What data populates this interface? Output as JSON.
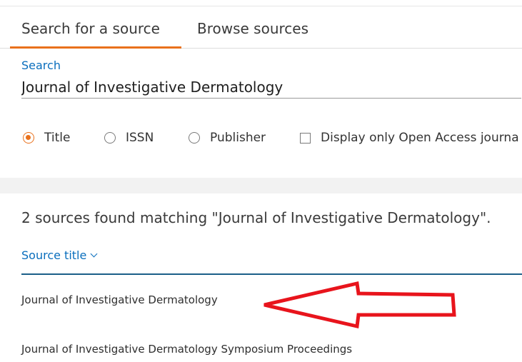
{
  "tabs": {
    "search": "Search for a source",
    "browse": "Browse sources",
    "active": "search"
  },
  "search": {
    "label": "Search",
    "value": "Journal of Investigative Dermatology"
  },
  "filters": {
    "options": [
      {
        "label": "Title",
        "selected": true
      },
      {
        "label": "ISSN",
        "selected": false
      },
      {
        "label": "Publisher",
        "selected": false
      }
    ],
    "open_access_label": "Display only Open Access journa",
    "open_access_checked": false
  },
  "results": {
    "count_text": "2 sources found matching \"Journal of Investigative Dermatology\".",
    "column_header": "Source title",
    "rows": [
      "Journal of Investigative Dermatology",
      "Journal of Investigative Dermatology Symposium Proceedings"
    ]
  },
  "colors": {
    "accent_orange": "#e9711c",
    "link_blue": "#0a6ebd",
    "annotation_red": "#e8141c"
  },
  "icons": {
    "sort": "chevron-down-icon",
    "annotation": "arrow-left-icon"
  }
}
